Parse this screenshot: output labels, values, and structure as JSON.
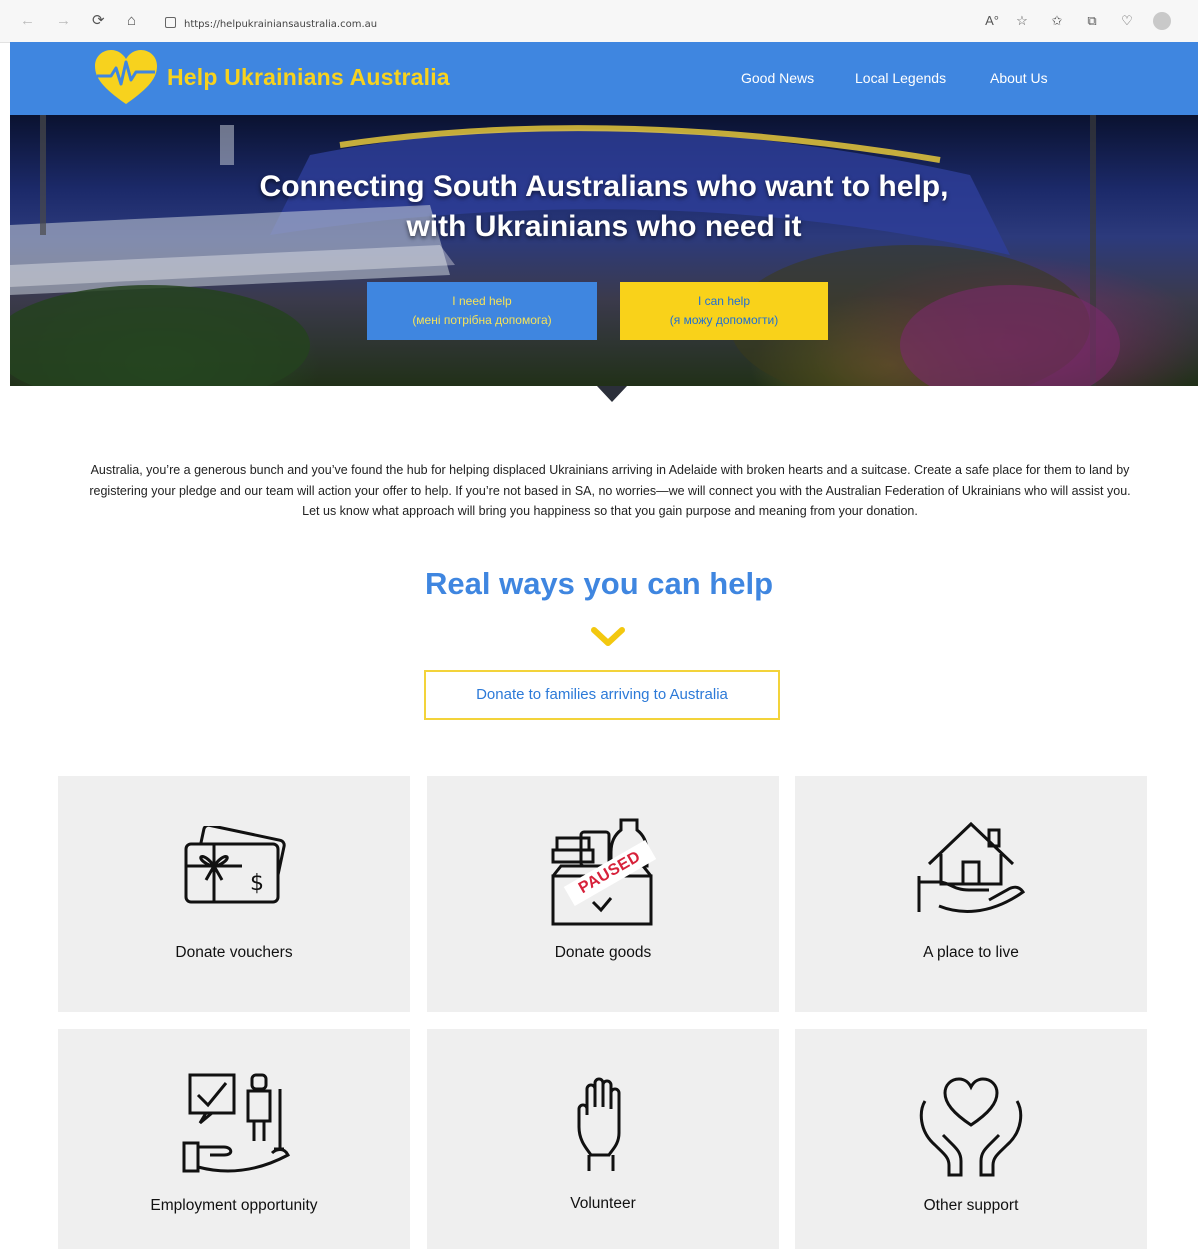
{
  "browser": {
    "back_icon": "back-arrow-icon",
    "back_glyph": "←",
    "forward_glyph": "→",
    "refresh_glyph": "⟳",
    "home_glyph": "⌂",
    "url": "https://helpukrainiansaustralia.com.au",
    "toolbar_glyphs": [
      "A°",
      "☆",
      "✩",
      "⧉",
      "♡"
    ]
  },
  "header": {
    "brand": "Help Ukrainians Australia",
    "nav": [
      "Good News",
      "Local Legends",
      "About Us"
    ]
  },
  "hero": {
    "title_line1": "Connecting South Australians who want to help,",
    "title_line2": "with Ukrainians who need it",
    "btn_need_help": "I need help",
    "btn_need_help_ua": "(мені потрібна допомога)",
    "btn_can_help": "I can help",
    "btn_can_help_ua": "(я можу допомогти)"
  },
  "intro": "Australia, you’re a generous bunch and you’ve found the hub for helping displaced Ukrainians arriving in Adelaide with broken hearts and a suitcase. Create a safe place for them to land by registering your pledge and our team will action your offer to help. If you’re not based in SA, no worries—we will connect you with the Australian Federation of Ukrainians who will assist you. Let us know what approach will bring you happiness so that you gain purpose and meaning from your donation.",
  "section": {
    "title": "Real ways you can help",
    "donate_button": "Donate to families arriving to Australia"
  },
  "cards": [
    {
      "label": "Donate vouchers",
      "icon": "gift-voucher-icon"
    },
    {
      "label": "Donate goods",
      "icon": "donation-box-icon",
      "badge": "PAUSED"
    },
    {
      "label": "A place to live",
      "icon": "house-in-hand-icon"
    },
    {
      "label": "Employment opportunity",
      "icon": "employment-icon"
    },
    {
      "label": "Volunteer",
      "icon": "raised-hand-icon"
    },
    {
      "label": "Other support",
      "icon": "heart-in-hands-icon"
    }
  ],
  "colors": {
    "brand_blue": "#3f86e0",
    "brand_yellow": "#f9d21a",
    "card_bg": "#efefef",
    "paused_red": "#d7213a"
  }
}
